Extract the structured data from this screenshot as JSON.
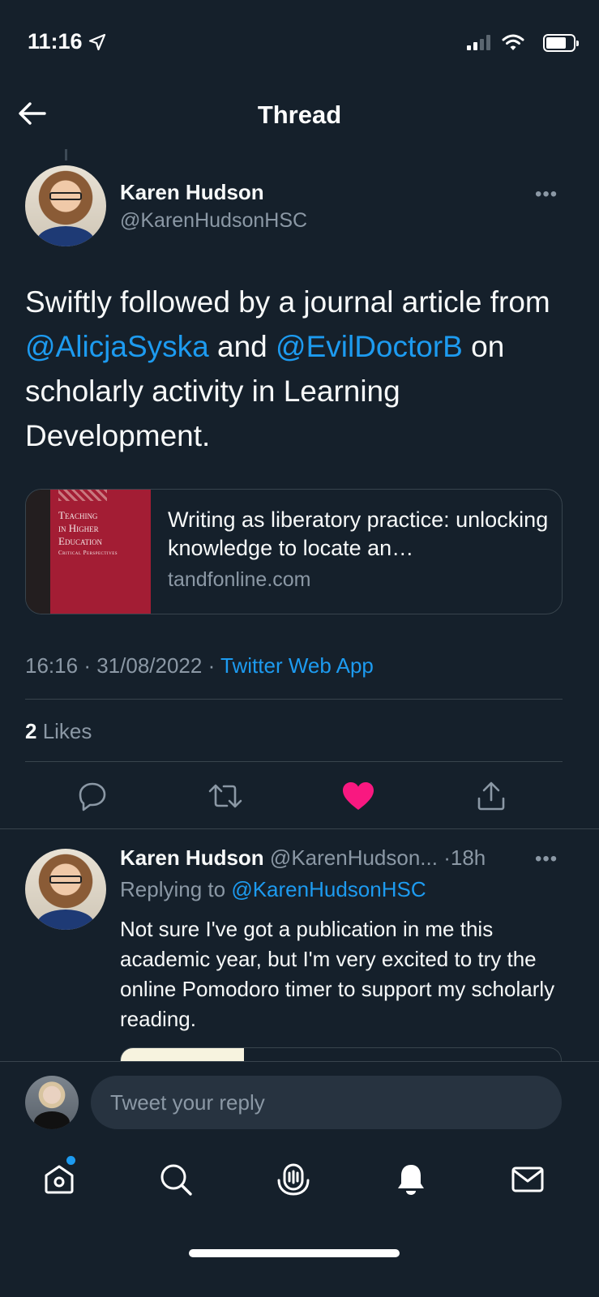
{
  "status_bar": {
    "time": "11:16"
  },
  "header": {
    "title": "Thread"
  },
  "tweet": {
    "author_name": "Karen Hudson",
    "author_handle": "@KarenHudsonHSC",
    "text_1": "Swiftly followed by a journal article from ",
    "mention_1": "@AlicjaSyska",
    "text_2": " and ",
    "mention_2": "@EvilDoctorB",
    "text_3": " on scholarly activity in Learning Development.",
    "card": {
      "cover_line_1": "Teaching",
      "cover_line_2": "in Higher",
      "cover_line_3": "Education",
      "cover_subtitle": "Critical Perspectives",
      "title": "Writing as liberatory practice: unlocking knowledge to locate an…",
      "domain": "tandfonline.com"
    },
    "time": "16:16",
    "date": "31/08/2022",
    "separator": "·",
    "source_app": "Twitter Web App",
    "likes_count": "2",
    "likes_label": " Likes",
    "liked": true,
    "like_color": "#f91880"
  },
  "reply": {
    "author_name": "Karen Hudson",
    "author_handle": "@KarenHudson...",
    "age": "18h",
    "replying_label": "Replying to ",
    "replying_to": "@KarenHudsonHSC",
    "text": "Not sure I've got a publication in me this academic year, but I'm very excited to try the online Pomodoro timer to support my scholarly reading."
  },
  "compose": {
    "placeholder": "Tweet your reply"
  },
  "tab_bar": {
    "items": [
      "home-icon",
      "search-icon",
      "spaces-icon",
      "notifications-icon",
      "messages-icon"
    ],
    "home_has_notification": true
  },
  "colors": {
    "background": "#15202b",
    "accent": "#1d9bf0",
    "secondary_text": "#8b98a5",
    "like": "#f91880"
  }
}
